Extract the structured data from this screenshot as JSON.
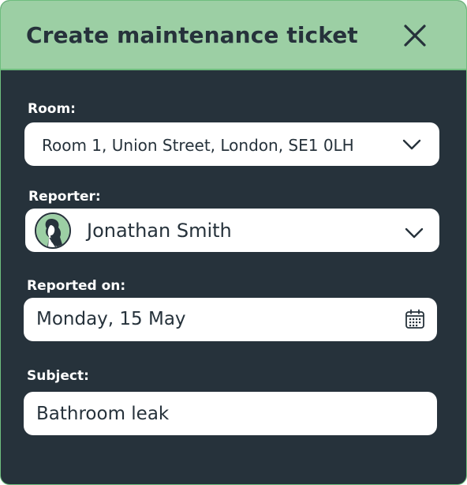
{
  "dialog": {
    "title": "Create maintenance ticket",
    "close_icon": "close-icon",
    "header_color": "#9ccfa4",
    "body_color": "#26323b"
  },
  "room": {
    "label": "Room:",
    "value": "Room 1, Union Street, London, SE1 0LH",
    "icon": "chevron-down-icon"
  },
  "reporter": {
    "label": "Reporter:",
    "value": "Jonathan Smith",
    "avatar_icon": "user-avatar",
    "icon": "chevron-down-icon"
  },
  "reported_on": {
    "label": "Reported on:",
    "value": "Monday, 15 May",
    "icon": "calendar-icon"
  },
  "subject": {
    "label": "Subject:",
    "value": "Bathroom leak"
  }
}
